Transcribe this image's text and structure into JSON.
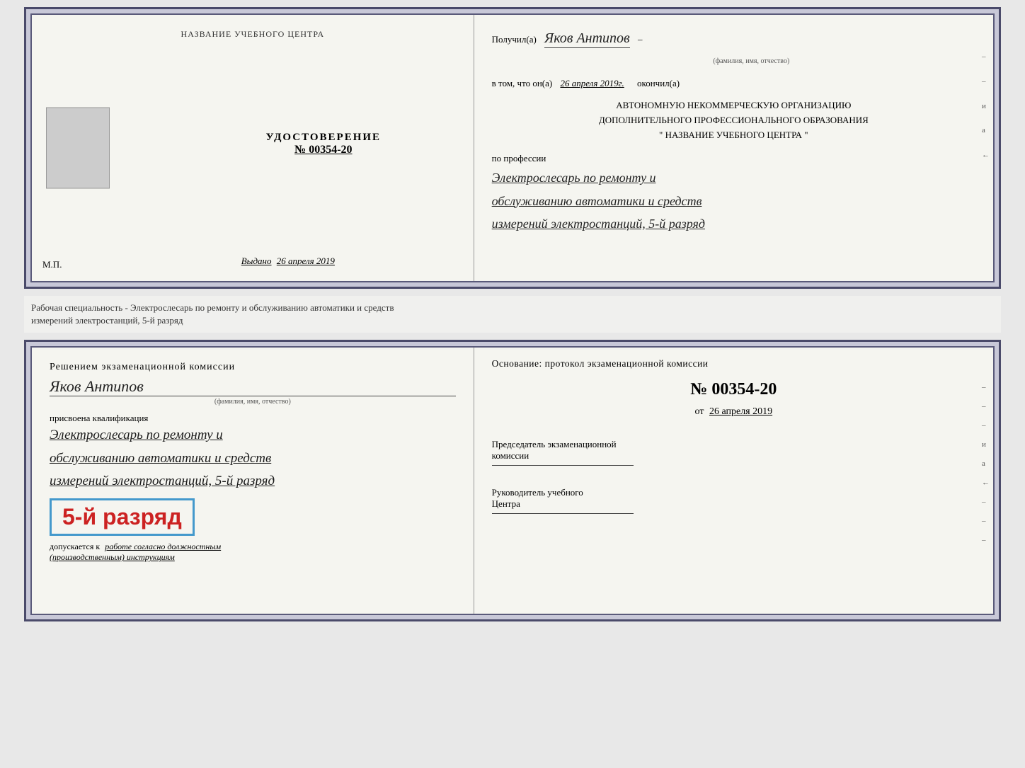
{
  "top_doc": {
    "left": {
      "center_title": "НАЗВАНИЕ УЧЕБНОГО ЦЕНТРА",
      "cert_label": "УДОСТОВЕРЕНИЕ",
      "cert_number": "№ 00354-20",
      "issued_label": "Выдано",
      "issued_date": "26 апреля 2019",
      "mp_label": "М.П."
    },
    "right": {
      "received_label": "Получил(а)",
      "person_name": "Яков Антипов",
      "fio_sublabel": "(фамилия, имя, отчество)",
      "in_that_label": "в том, что он(а)",
      "completed_date": "26 апреля 2019г.",
      "completed_label": "окончил(а)",
      "org_line1": "АВТОНОМНУЮ НЕКОММЕРЧЕСКУЮ ОРГАНИЗАЦИЮ",
      "org_line2": "ДОПОЛНИТЕЛЬНОГО ПРОФЕССИОНАЛЬНОГО ОБРАЗОВАНИЯ",
      "org_line3": "\"   НАЗВАНИЕ УЧЕБНОГО ЦЕНТРА   \"",
      "profession_label": "по профессии",
      "profession_line1": "Электрослесарь по ремонту и",
      "profession_line2": "обслуживанию автоматики и средств",
      "profession_line3": "измерений электростанций, 5-й разряд"
    }
  },
  "separator": {
    "text": "Рабочая специальность - Электрослесарь по ремонту и обслуживанию автоматики и средств\nизмерений электростанций, 5-й разряд"
  },
  "bottom_doc": {
    "left": {
      "decision_label": "Решением экзаменационной комиссии",
      "person_name": "Яков Антипов",
      "fio_sublabel": "(фамилия, имя, отчество)",
      "qualification_label": "присвоена квалификация",
      "qual_line1": "Электрослесарь по ремонту и",
      "qual_line2": "обслуживанию автоматики и средств",
      "qual_line3": "измерений электростанций, 5-й разряд",
      "rank_text": "5-й разряд",
      "допускается_prefix": "допускается к",
      "допускается_text": "работе согласно должностным",
      "instructions_text": "(производственным) инструкциям"
    },
    "right": {
      "basis_label": "Основание: протокол экзаменационной комиссии",
      "number_label": "№  00354-20",
      "date_prefix": "от",
      "date_value": "26 апреля 2019",
      "chairman_line1": "Председатель экзаменационной",
      "chairman_line2": "комиссии",
      "director_line1": "Руководитель учебного",
      "director_line2": "Центра"
    }
  },
  "side_marks": [
    "–",
    "–",
    "и",
    "а",
    "←",
    "–",
    "–",
    "–",
    "–"
  ]
}
